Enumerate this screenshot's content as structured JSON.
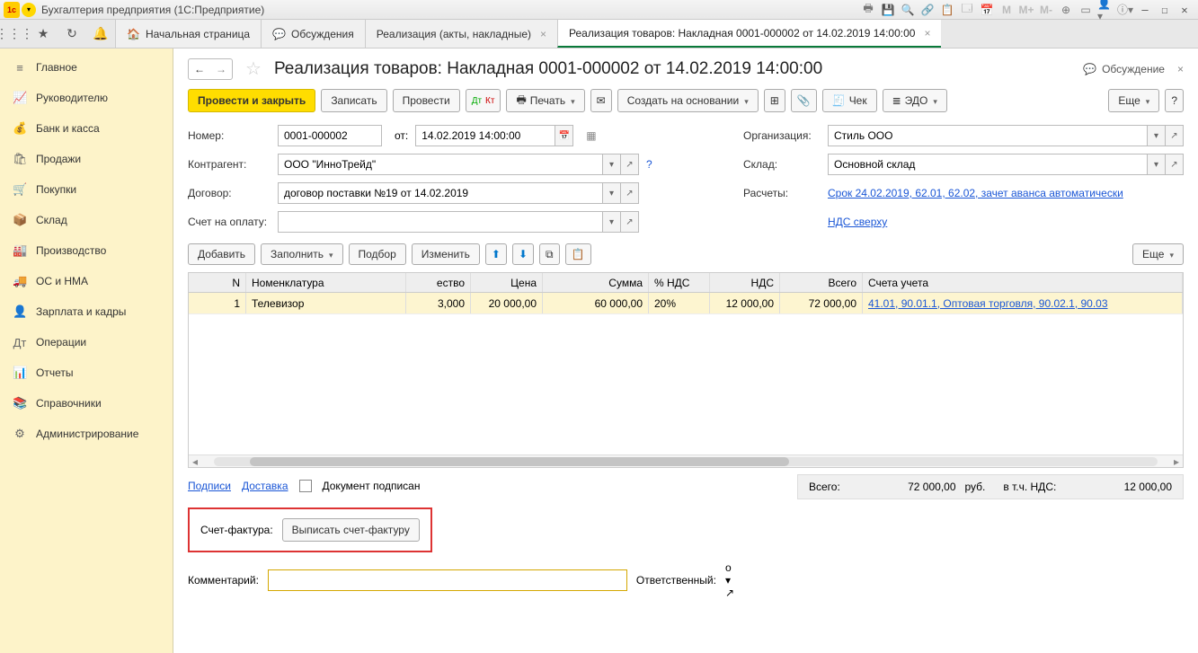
{
  "titlebar": {
    "title": "Бухгалтерия предприятия  (1С:Предприятие)"
  },
  "tabs": {
    "home": "Начальная страница",
    "discussions": "Обсуждения",
    "real_list": "Реализация (акты, накладные)",
    "current": "Реализация товаров: Накладная 0001-000002 от 14.02.2019 14:00:00"
  },
  "sidebar": [
    "Главное",
    "Руководителю",
    "Банк и касса",
    "Продажи",
    "Покупки",
    "Склад",
    "Производство",
    "ОС и НМА",
    "Зарплата и кадры",
    "Операции",
    "Отчеты",
    "Справочники",
    "Администрирование"
  ],
  "sidebar_icons": [
    "≡",
    "📈",
    "💰",
    "🛍",
    "🛒",
    "📦",
    "🏭",
    "🚚",
    "👤",
    "Дт",
    "📊",
    "📚",
    "⚙"
  ],
  "doc": {
    "title": "Реализация товаров: Накладная 0001-000002 от 14.02.2019 14:00:00",
    "discuss": "Обсуждение"
  },
  "buttons": {
    "post_close": "Провести и закрыть",
    "save": "Записать",
    "post": "Провести",
    "print": "Печать",
    "create_based": "Создать на основании",
    "check": "Чек",
    "edo": "ЭДО",
    "more": "Еще",
    "help": "?"
  },
  "form": {
    "number_lbl": "Номер:",
    "number": "0001-000002",
    "from_lbl": "от:",
    "date": "14.02.2019 14:00:00",
    "org_lbl": "Организация:",
    "org": "Стиль ООО",
    "contr_lbl": "Контрагент:",
    "contr": "ООО \"ИнноТрейд\"",
    "wh_lbl": "Склад:",
    "wh": "Основной склад",
    "contract_lbl": "Договор:",
    "contract": "договор поставки №19 от 14.02.2019",
    "calc_lbl": "Расчеты:",
    "calc_link": "Срок 24.02.2019, 62.01, 62.02, зачет аванса автоматически",
    "invoice_lbl": "Счет на оплату:",
    "vat_link": "НДС сверху"
  },
  "tabletb": {
    "add": "Добавить",
    "fill": "Заполнить",
    "select": "Подбор",
    "change": "Изменить",
    "more": "Еще"
  },
  "thead": {
    "n": "N",
    "nom": "Номенклатура",
    "qty": "ество",
    "price": "Цена",
    "sum": "Сумма",
    "vatp": "% НДС",
    "vat": "НДС",
    "total": "Всего",
    "acc": "Счета учета"
  },
  "rows": [
    {
      "n": "1",
      "nom": "Телевизор",
      "qty": "3,000",
      "price": "20 000,00",
      "sum": "60 000,00",
      "vatp": "20%",
      "vat": "12 000,00",
      "total": "72 000,00",
      "acc": "41.01, 90.01.1, Оптовая торговля, 90.02.1, 90.03"
    }
  ],
  "sig": {
    "podpisi": "Подписи",
    "delivery": "Доставка",
    "doc_signed": "Документ подписан"
  },
  "totals": {
    "label": "Всего:",
    "sum": "72 000,00",
    "cur": "руб.",
    "vat_lbl": "в т.ч. НДС:",
    "vat": "12 000,00"
  },
  "invoice": {
    "lbl": "Счет-фактура:",
    "btn": "Выписать счет-фактуру"
  },
  "comment": {
    "lbl": "Комментарий:",
    "resp_lbl": "Ответственный:",
    "resp": "о"
  }
}
